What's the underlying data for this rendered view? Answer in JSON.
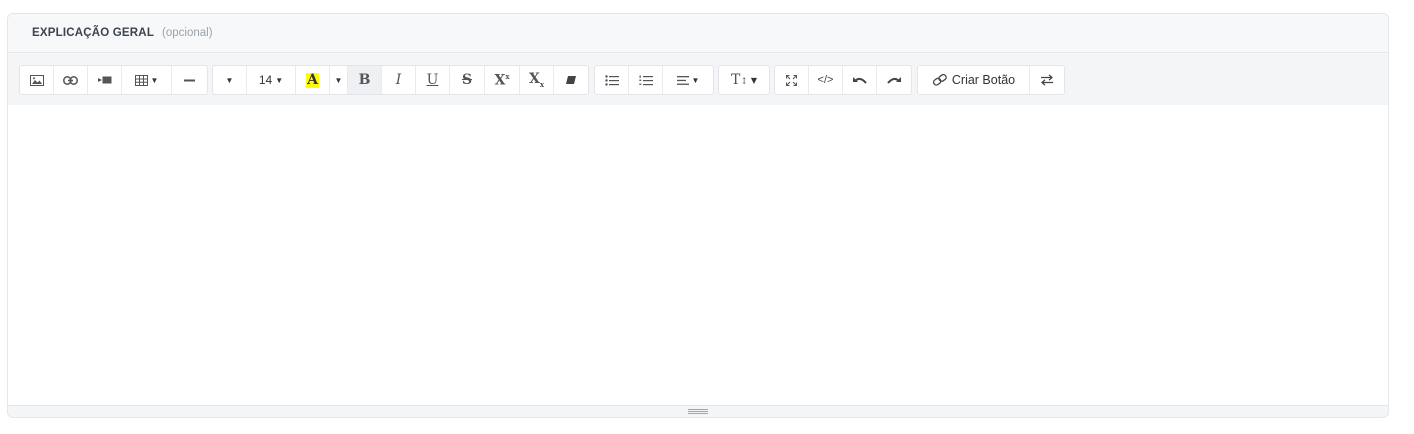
{
  "section": {
    "title": "EXPLICAÇÃO GERAL",
    "optional_label": "(opcional)"
  },
  "toolbar": {
    "insert": [
      "image-icon",
      "link-icon",
      "video-icon",
      "table-icon",
      "horizontal-rule-icon"
    ],
    "font_size": "14",
    "highlight_letter": "A",
    "highlight_color": "#ffff00",
    "format": {
      "bold": "B",
      "italic": "I",
      "underline": "U",
      "strikethrough": "S",
      "superscript": "X",
      "subscript": "X"
    },
    "paragraph_style": "T",
    "code_view": "</>",
    "create_button_label": "Criar Botão"
  },
  "editor": {
    "content": ""
  },
  "colors": {
    "toolbar_bg": "#f4f5f7",
    "border": "#e3e6ea",
    "title": "#3b4350",
    "muted": "#9aa3ad"
  }
}
